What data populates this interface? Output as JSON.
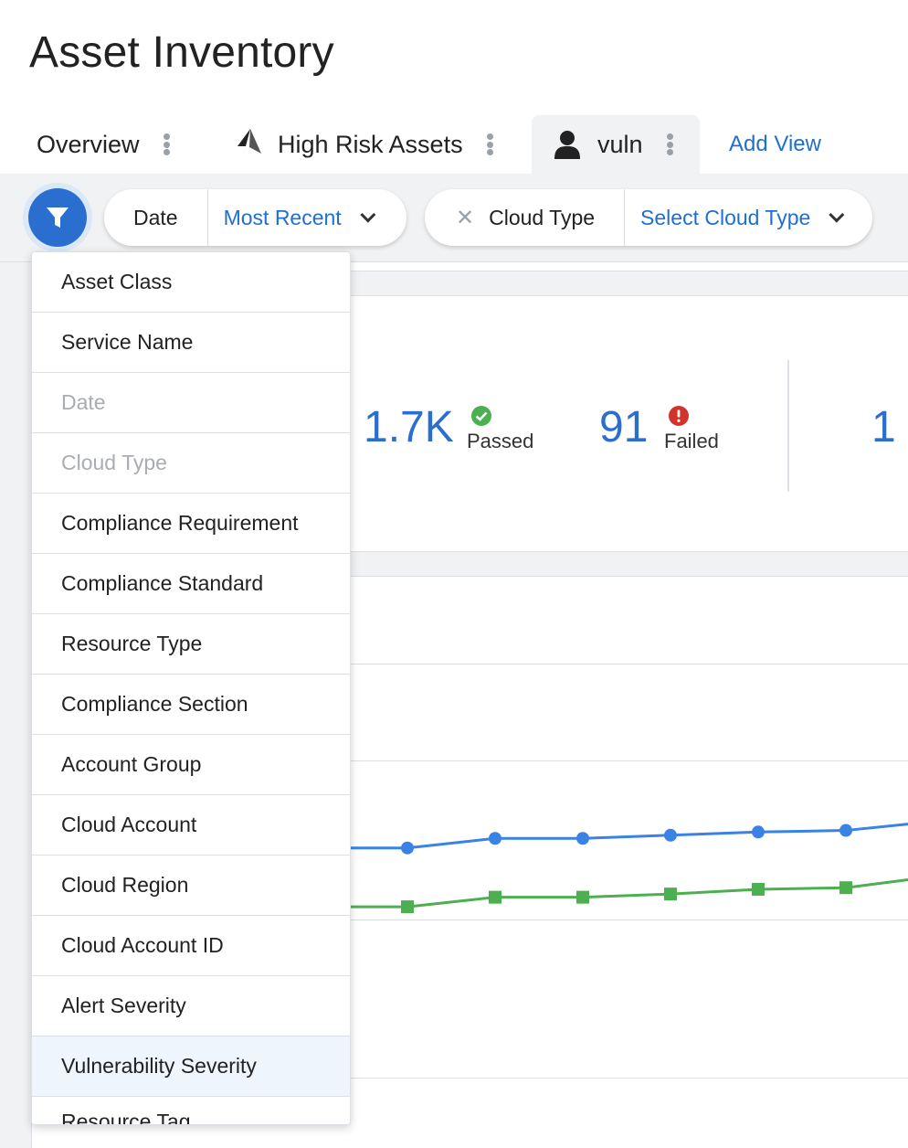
{
  "page": {
    "title": "Asset Inventory"
  },
  "tabs": [
    {
      "label": "Overview",
      "icon": "none",
      "active": false
    },
    {
      "label": "High Risk Assets",
      "icon": "rocket-icon",
      "active": false
    },
    {
      "label": "vuln",
      "icon": "user-icon",
      "active": true
    }
  ],
  "add_view_label": "Add View",
  "filters": {
    "date": {
      "label": "Date",
      "value": "Most Recent"
    },
    "cloud_type": {
      "label": "Cloud Type",
      "value": "Select Cloud Type",
      "remove_icon": "close-icon"
    }
  },
  "stats": {
    "passed": {
      "value": "1.7K",
      "label": "Passed",
      "status_color": "#4caf50"
    },
    "failed": {
      "value": "91",
      "label": "Failed",
      "status_color": "#d0342c"
    },
    "third": {
      "value": "1"
    }
  },
  "dropdown": {
    "items": [
      {
        "label": "Asset Class",
        "state": "normal"
      },
      {
        "label": "Service Name",
        "state": "normal"
      },
      {
        "label": "Date",
        "state": "disabled"
      },
      {
        "label": "Cloud Type",
        "state": "disabled"
      },
      {
        "label": "Compliance Requirement",
        "state": "normal"
      },
      {
        "label": "Compliance Standard",
        "state": "normal"
      },
      {
        "label": "Resource Type",
        "state": "normal"
      },
      {
        "label": "Compliance Section",
        "state": "normal"
      },
      {
        "label": "Account Group",
        "state": "normal"
      },
      {
        "label": "Cloud Account",
        "state": "normal"
      },
      {
        "label": "Cloud Region",
        "state": "normal"
      },
      {
        "label": "Cloud Account ID",
        "state": "normal"
      },
      {
        "label": "Alert Severity",
        "state": "normal"
      },
      {
        "label": "Vulnerability Severity",
        "state": "highlighted"
      },
      {
        "label": "Resource Tag",
        "state": "partially-visible"
      }
    ]
  },
  "colors": {
    "accent": "#2a6fd0",
    "link": "#1f6fd1",
    "series_blue": "#3a82e4",
    "series_green": "#4caf50"
  },
  "chart_data": {
    "type": "line",
    "series": [
      {
        "values": [
          null,
          0.955,
          0.949,
          0.949,
          0.947,
          0.945,
          0.944,
          0.94
        ]
      },
      {
        "values": [
          null,
          0.992,
          0.986,
          0.986,
          0.984,
          0.981,
          0.98,
          0.975
        ]
      }
    ],
    "note_visible": "y-axis and tick labels are hidden behind the dropdown"
  }
}
